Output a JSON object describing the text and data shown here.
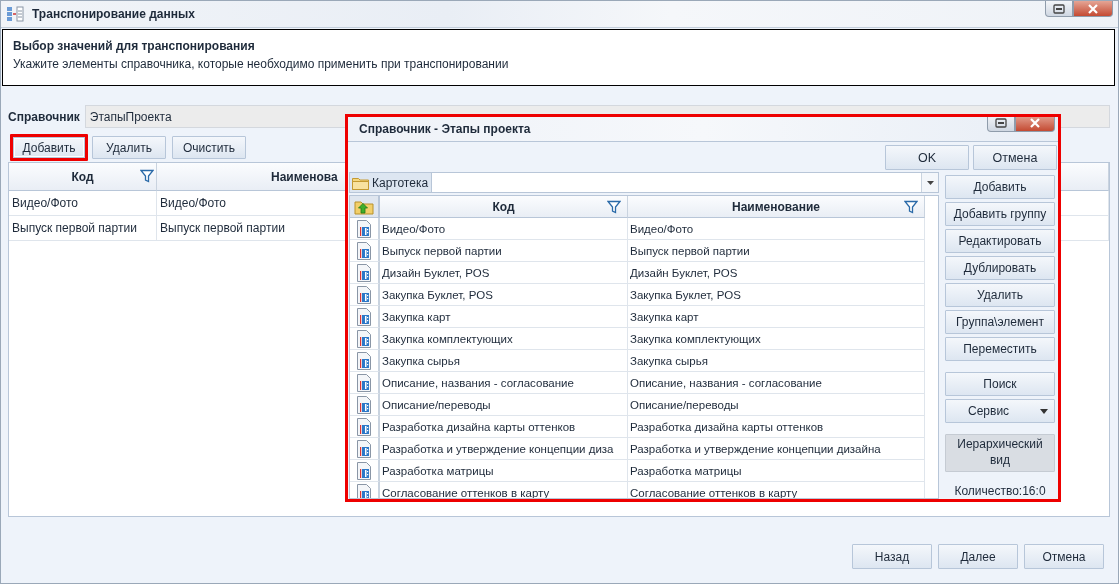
{
  "window": {
    "title": "Транспонирование данных"
  },
  "header": {
    "title": "Выбор значений для транспонирования",
    "subtitle": "Укажите элементы справочника, которые необходимо применить при транспонировании"
  },
  "reference_field": {
    "label": "Справочник",
    "value": "ЭтапыПроекта"
  },
  "toolbar": [
    {
      "label": "Добавить",
      "highlighted": true
    },
    {
      "label": "Удалить",
      "highlighted": false
    },
    {
      "label": "Очистить",
      "highlighted": false
    }
  ],
  "table": {
    "columns": [
      {
        "label": "Код",
        "filter": true
      },
      {
        "label": "Наименова",
        "filter": false
      }
    ],
    "rows": [
      [
        "Видео/Фото",
        "Видео/Фото"
      ],
      [
        "Выпуск первой партии",
        "Выпуск первой партии"
      ]
    ]
  },
  "dialog": {
    "title": "Справочник - Этапы проекта",
    "highlighted": true,
    "buttons": [
      "OK",
      "Отмена"
    ],
    "folder_tab": "Картотека",
    "columns": [
      {
        "label": "Код",
        "filter": true
      },
      {
        "label": "Наименование",
        "filter": true
      }
    ],
    "rows": [
      [
        "Видео/Фото",
        "Видео/Фото"
      ],
      [
        "Выпуск первой партии",
        "Выпуск первой партии"
      ],
      [
        "Дизайн Буклет, POS",
        "Дизайн Буклет, POS"
      ],
      [
        "Закупка Буклет, POS",
        "Закупка Буклет, POS"
      ],
      [
        "Закупка карт",
        "Закупка карт"
      ],
      [
        "Закупка комплектующих",
        "Закупка комплектующих"
      ],
      [
        "Закупка сырья",
        "Закупка сырья"
      ],
      [
        "Описание, названия - согласование",
        "Описание, названия - согласование"
      ],
      [
        "Описание/переводы",
        "Описание/переводы"
      ],
      [
        "Разработка дизайна карты оттенков",
        "Разработка дизайна карты оттенков"
      ],
      [
        "Разработка и утверждение концепции диза",
        "Разработка и утверждение концепции дизайна"
      ],
      [
        "Разработка матрицы",
        "Разработка матрицы"
      ],
      [
        "Согласование оттенков в карту",
        "Согласование оттенков в карту"
      ]
    ],
    "actions": [
      {
        "label": "Добавить",
        "kind": "plain",
        "separated": false
      },
      {
        "label": "Добавить группу",
        "kind": "plain",
        "separated": false
      },
      {
        "label": "Редактировать",
        "kind": "plain",
        "separated": false
      },
      {
        "label": "Дублировать",
        "kind": "plain",
        "separated": false
      },
      {
        "label": "Удалить",
        "kind": "plain",
        "separated": false
      },
      {
        "label": "Группа\\элемент",
        "kind": "plain",
        "separated": false
      },
      {
        "label": "Переместить",
        "kind": "plain",
        "separated": false
      },
      {
        "label": "Поиск",
        "kind": "plain",
        "separated": true
      },
      {
        "label": "Сервис",
        "kind": "dropdown",
        "separated": false
      },
      {
        "label": "Иерархический вид",
        "kind": "toggle",
        "separated": true
      }
    ],
    "count": "Количество:16:0"
  },
  "footer_buttons": [
    "Назад",
    "Далее",
    "Отмена"
  ]
}
